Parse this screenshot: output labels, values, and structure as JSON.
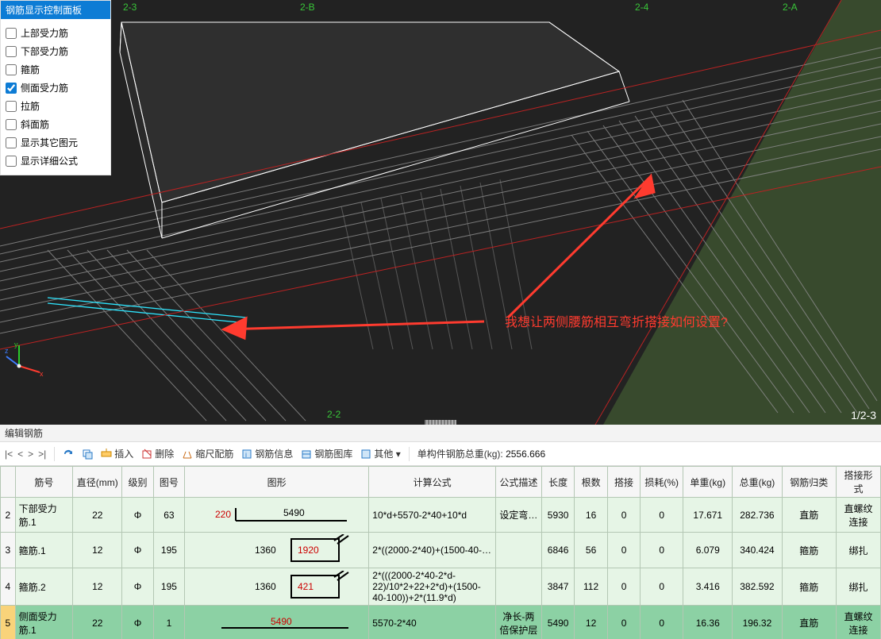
{
  "panel": {
    "title": "钢筋显示控制面板",
    "options": [
      {
        "label": "上部受力筋",
        "checked": false
      },
      {
        "label": "下部受力筋",
        "checked": false
      },
      {
        "label": "箍筋",
        "checked": false
      },
      {
        "label": "侧面受力筋",
        "checked": true
      },
      {
        "label": "拉筋",
        "checked": false
      },
      {
        "label": "斜面筋",
        "checked": false
      },
      {
        "label": "显示其它图元",
        "checked": false
      },
      {
        "label": "显示详细公式",
        "checked": false
      }
    ]
  },
  "viewport": {
    "grid_labels": {
      "tl1": "2-3",
      "tl2": "2-B",
      "tr1": "2-4",
      "tr2": "2-A",
      "b": "2-2",
      "br": "1/2-3"
    },
    "annotation": "我想让两侧腰筋相互弯折搭接如何设置?"
  },
  "section_title": "编辑钢筋",
  "toolbar": {
    "nav": [
      "|<",
      "<",
      ">",
      ">|"
    ],
    "insert": "插入",
    "delete": "删除",
    "scale": "缩尺配筋",
    "info": "钢筋信息",
    "lib": "钢筋图库",
    "other": "其他 ▾",
    "total_label": "单构件钢筋总重(kg):",
    "total_value": "2556.666"
  },
  "grid": {
    "columns": [
      "",
      "筋号",
      "直径(mm)",
      "级别",
      "图号",
      "图形",
      "计算公式",
      "公式描述",
      "长度",
      "根数",
      "搭接",
      "损耗(%)",
      "单重(kg)",
      "总重(kg)",
      "钢筋归类",
      "搭接形式"
    ],
    "rows": [
      {
        "n": "2",
        "name": "下部受力筋.1",
        "dia": "22",
        "grade": "Φ",
        "fig": "63",
        "shape": {
          "type": "L",
          "red": "220",
          "blk": "5490"
        },
        "formula": "10*d+5570-2*40+10*d",
        "desc": "设定弯…",
        "len": "5930",
        "count": "16",
        "lap": "0",
        "loss": "0",
        "uw": "17.671",
        "tw": "282.736",
        "cat": "直筋",
        "lapform": "直螺纹连接"
      },
      {
        "n": "3",
        "name": "箍筋.1",
        "dia": "12",
        "grade": "Φ",
        "fig": "195",
        "shape": {
          "type": "STIR",
          "blk": "1360",
          "red": "1920"
        },
        "formula": "2*((2000-2*40)+(1500-40-…",
        "desc": "",
        "len": "6846",
        "count": "56",
        "lap": "0",
        "loss": "0",
        "uw": "6.079",
        "tw": "340.424",
        "cat": "箍筋",
        "lapform": "绑扎"
      },
      {
        "n": "4",
        "name": "箍筋.2",
        "dia": "12",
        "grade": "Φ",
        "fig": "195",
        "shape": {
          "type": "STIR",
          "blk": "1360",
          "red": "421"
        },
        "formula": "2*(((2000-2*40-2*d-22)/10*2+22+2*d)+(1500-40-100))+2*(11.9*d)",
        "desc": "",
        "len": "3847",
        "count": "112",
        "lap": "0",
        "loss": "0",
        "uw": "3.416",
        "tw": "382.592",
        "cat": "箍筋",
        "lapform": "绑扎"
      },
      {
        "n": "5",
        "name": "侧面受力筋.1",
        "dia": "22",
        "grade": "Φ",
        "fig": "1",
        "shape": {
          "type": "LINE",
          "red": "5490"
        },
        "formula": "5570-2*40",
        "desc": "净长-两倍保护层",
        "len": "5490",
        "count": "12",
        "lap": "0",
        "loss": "0",
        "uw": "16.36",
        "tw": "196.32",
        "cat": "直筋",
        "lapform": "直螺纹连接",
        "selected": true
      }
    ]
  }
}
